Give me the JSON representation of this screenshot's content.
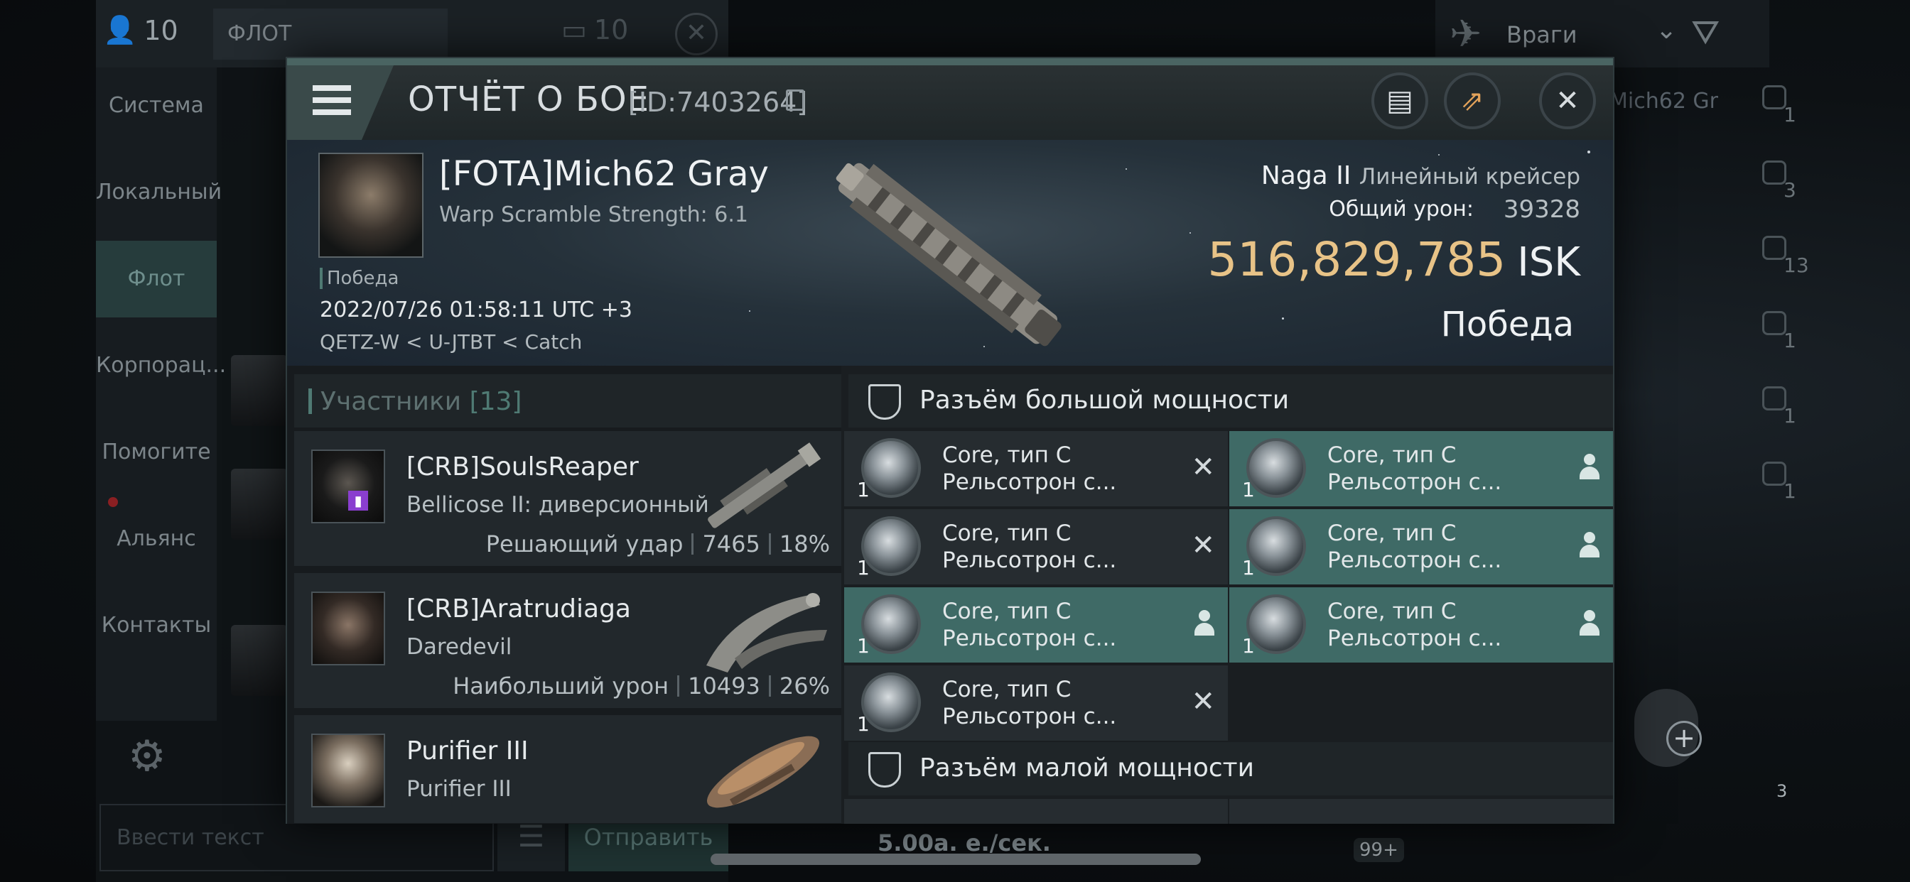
{
  "chat": {
    "members_count": "10",
    "channel_label": "ФЛОТ",
    "secondary_count": "10",
    "nav": [
      "Система",
      "Локальный",
      "Флот",
      "Корпорац...",
      "Помогите",
      "Альянс",
      "Контакты"
    ],
    "input_placeholder": "Ввести текст",
    "send_label": "Отправить"
  },
  "overview": {
    "filter_label": "Враги",
    "behind_name": "Mich62 Gr",
    "side_counts": [
      "1",
      "3",
      "13",
      "1",
      "1",
      "1"
    ],
    "hud_badge": "3",
    "bottom_badge": "99+",
    "rate": "5.00а. е./сек."
  },
  "report": {
    "title": "ОТЧЁТ О БОЕ",
    "id": "[ID:7403264]",
    "victim": {
      "name": "[FOTA]Mich62 Gray",
      "warp": "Warp Scramble Strength: 6.1",
      "tag": "Победа",
      "date": "2022/07/26 01:58:11 UTC +3",
      "location": "QETZ-W < U-JTBT < Catch",
      "ship": "Naga II",
      "ship_class": "Линейный крейсер",
      "damage_label": "Общий урон:",
      "damage": "39328",
      "isk_value": "516,829,785",
      "isk_unit": "ISK",
      "result": "Победа"
    },
    "participants_label": "Участники",
    "participants_count": "[13]",
    "participants": [
      {
        "name": "[CRB]SoulsReaper",
        "ship": "Bellicose II: диверсионный",
        "stat_label": "Решающий удар",
        "damage": "7465",
        "percent": "18%"
      },
      {
        "name": "[CRB]Aratrudiaga",
        "ship": "Daredevil",
        "stat_label": "Наибольший урон",
        "damage": "10493",
        "percent": "26%"
      },
      {
        "name": "Purifier III",
        "ship": "Purifier III",
        "stat_label": "",
        "damage": "",
        "percent": ""
      }
    ],
    "high_slot_label": "Разъём большой мощности",
    "low_slot_label": "Разъём малой мощности",
    "modules": [
      {
        "line1": "Core, тип C",
        "line2": "Рельсотрон с...",
        "qty": "1",
        "state": "destroyed"
      },
      {
        "line1": "Core, тип C",
        "line2": "Рельсотрон с...",
        "qty": "1",
        "state": "dropped"
      },
      {
        "line1": "Core, тип C",
        "line2": "Рельсотрон с...",
        "qty": "1",
        "state": "destroyed"
      },
      {
        "line1": "Core, тип C",
        "line2": "Рельсотрон с...",
        "qty": "1",
        "state": "dropped"
      },
      {
        "line1": "Core, тип C",
        "line2": "Рельсотрон с...",
        "qty": "1",
        "state": "dropped"
      },
      {
        "line1": "Core, тип C",
        "line2": "Рельсотрон с...",
        "qty": "1",
        "state": "dropped"
      },
      {
        "line1": "Core, тип C",
        "line2": "Рельсотрон с...",
        "qty": "1",
        "state": "destroyed"
      }
    ]
  }
}
